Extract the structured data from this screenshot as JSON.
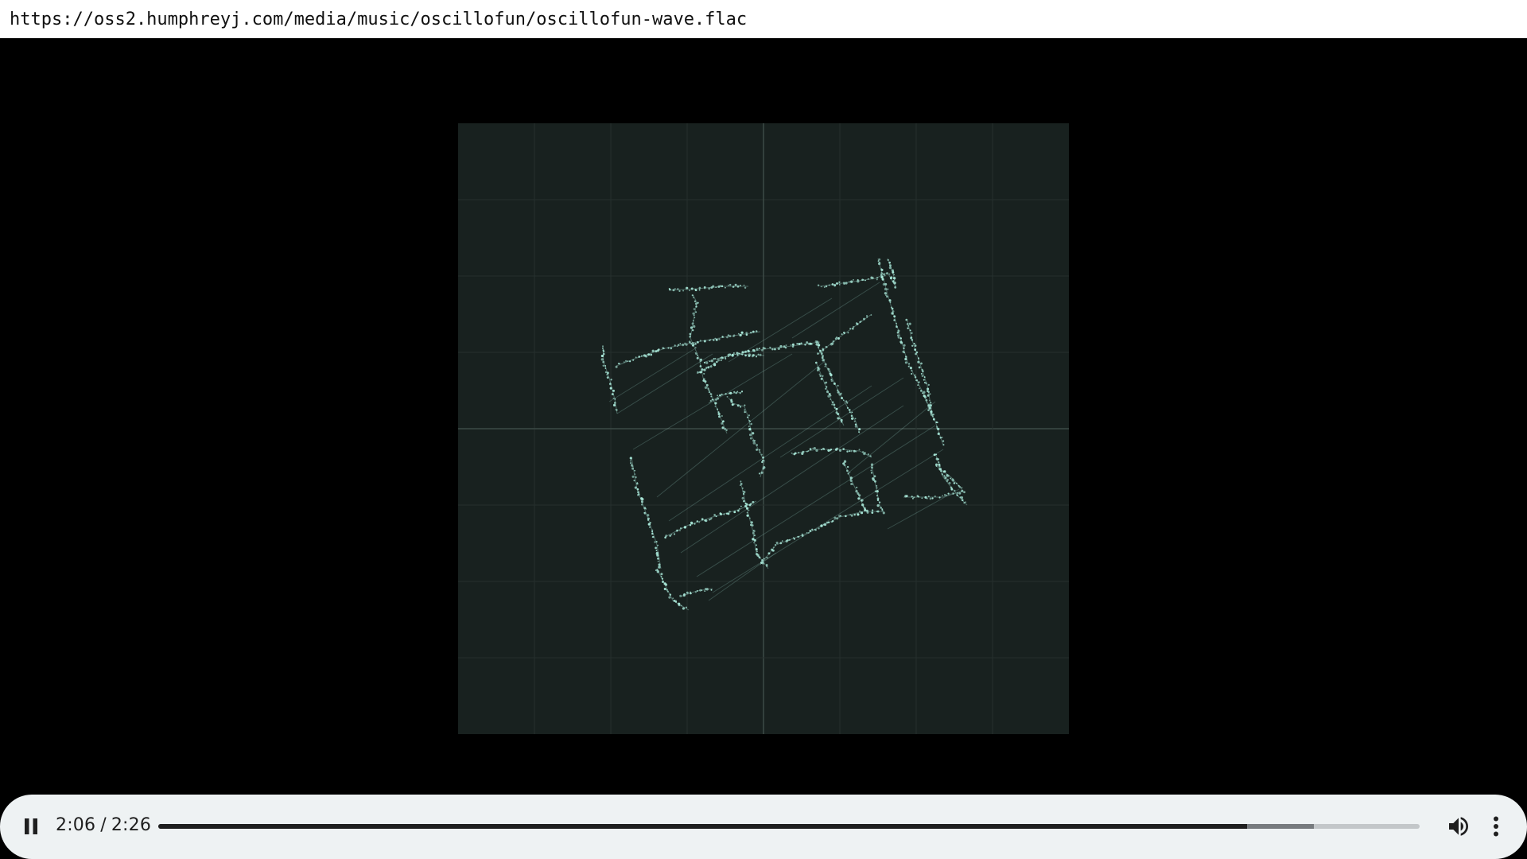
{
  "address_bar": {
    "url": "https://oss2.humphreyj.com/media/music/oscillofun/oscillofun-wave.flac"
  },
  "visualizer": {
    "background_color": "#18211f",
    "grid_color": "#26302e",
    "axis_color": "#3c4a47",
    "trace_color": "#a9e8d9"
  },
  "player": {
    "state": "playing",
    "play_pause_icon": "pause-icon",
    "current_time": "2:06",
    "separator": "/",
    "duration": "2:26",
    "progress_fraction": 0.863,
    "buffered_fraction": 0.916,
    "volume_icon": "volume-icon",
    "menu_icon": "more-vert-icon",
    "background_color": "#eef2f3"
  }
}
